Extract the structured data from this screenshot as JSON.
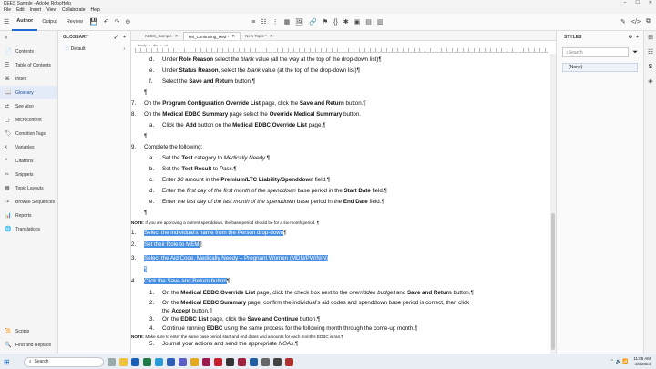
{
  "window": {
    "title": "KEES Sample - Adobe RoboHelp",
    "controls": [
      "–",
      "☐",
      "✕"
    ]
  },
  "menu": [
    "File",
    "Edit",
    "Insert",
    "View",
    "Collaborate",
    "Help"
  ],
  "toolbar": {
    "tabs": [
      "Author",
      "Output",
      "Review"
    ]
  },
  "left_nav": {
    "items": [
      {
        "label": "Contents",
        "icon": "contents-icon"
      },
      {
        "label": "Table of Contents",
        "icon": "toc-icon"
      },
      {
        "label": "Index",
        "icon": "index-icon"
      },
      {
        "label": "Glossary",
        "icon": "glossary-icon"
      },
      {
        "label": "See Also",
        "icon": "see-also-icon"
      },
      {
        "label": "Microcontent",
        "icon": "microcontent-icon"
      },
      {
        "label": "Condition Tags",
        "icon": "condition-tags-icon"
      },
      {
        "label": "Variables",
        "icon": "variables-icon"
      },
      {
        "label": "Citations",
        "icon": "citations-icon"
      },
      {
        "label": "Snippets",
        "icon": "snippets-icon"
      },
      {
        "label": "Topic Layouts",
        "icon": "topic-layouts-icon"
      },
      {
        "label": "Browse Sequences",
        "icon": "browse-sequences-icon"
      },
      {
        "label": "Reports",
        "icon": "reports-icon"
      },
      {
        "label": "Translations",
        "icon": "translations-icon"
      }
    ],
    "bottom": [
      {
        "label": "Scripts",
        "icon": "scripts-icon"
      },
      {
        "label": "Find and Replace",
        "icon": "find-replace-icon"
      }
    ]
  },
  "glossary": {
    "title": "GLOSSARY",
    "items": [
      "Default"
    ]
  },
  "editor": {
    "tabs": [
      "KEES_Sample",
      "FM_Continuing_Med *",
      "New Topic *"
    ],
    "breadcrumb": [
      "body",
      "div",
      "ol"
    ],
    "lines": [
      {
        "m": "d.",
        "t": "Under <b>Role Reason</b> select the <i>blank</i> value (all the way at the top of the drop-down list)¶",
        "ind": 1
      },
      {
        "m": "e.",
        "t": "Under <b>Status Reason</b>, select the <i>blank</i> value (at the top of the drop-down list)¶",
        "ind": 1
      },
      {
        "m": "f.",
        "t": "Select the <b>Save and Return</b> button.¶",
        "ind": 1
      },
      {
        "m": "",
        "t": "¶",
        "ind": 0
      },
      {
        "m": "7.",
        "t": "On the <b>Program Configuration Override List</b> page, click the <b>Save and Return</b> button.¶",
        "ind": 0
      },
      {
        "m": "8.",
        "t": "On the <b>Medical EDBC Summary</b> page select the <b>Override Medical Summary</b> button.",
        "ind": 0
      },
      {
        "m": "a.",
        "t": "Click the <b>Add</b> button on the <b>Medical EDBC Override List</b> page.¶",
        "ind": 1
      },
      {
        "m": "",
        "t": "¶",
        "ind": 0
      },
      {
        "m": "9.",
        "t": "Complete the following:",
        "ind": 0
      },
      {
        "m": "a.",
        "t": "Set the <b>Test</b> category to <i>Medically Needy</i>.¶",
        "ind": 1
      },
      {
        "m": "b.",
        "t": "Set the <b>Test Result</b> to <i>Pass</i>.¶",
        "ind": 1
      },
      {
        "m": "c.",
        "t": "Enter <i>$0</i> amount in the <b>Premium/LTC Liability/Spenddown</b> field.¶",
        "ind": 1
      },
      {
        "m": "d.",
        "t": "Enter the <i>first day of the first month of the spenddown</i> base period in the <b>Start Date</b> field.¶",
        "ind": 1
      },
      {
        "m": "e.",
        "t": "Enter the <i>last day of the last month of the spenddown</i> base period in the <b>End Date</b> field.¶",
        "ind": 1
      },
      {
        "m": "",
        "t": "¶",
        "ind": 0
      },
      {
        "m": "",
        "t": "<b>NOTE</b>: If you are approving a current spenddown, the base period should be for a six-month period. ¶",
        "ind": 0,
        "small": true
      },
      {
        "m": "1.",
        "t": "<span class=\"sel\">Select the individual's name from the Person drop-down</span>¶",
        "ind": 0
      },
      {
        "m": "2.",
        "t": "<span class=\"sel\">Set their Role to MEM</span>¶",
        "ind": 0
      },
      {
        "m": "3.",
        "t": "<span class=\"sel\">Select the Aid Code, Medically Needy – Pregnant Women (MDN/PW/N/N)</span>",
        "ind": 0
      },
      {
        "m": "",
        "t": "<span class=\"sel\">¶</span>",
        "ind": 0
      },
      {
        "m": "4.",
        "t": "<span class=\"sel\">Click the Save and Return button</span>¶",
        "ind": 0
      },
      {
        "m": "1.",
        "t": "On the <b>Medical EDBC Override List</b> page, click the check box next to the <i>overridden budget</i> and <b>Save and Return</b> button.¶",
        "ind": 1
      },
      {
        "m": "2.",
        "t": "On the <b>Medical EDBC Summary</b> page, confirm the individual's aid codes and spenddown base period is correct, then click",
        "ind": 1
      },
      {
        "m": "",
        "t": "the <b>Accept</b> button.¶",
        "ind": 1
      },
      {
        "m": "3.",
        "t": "On the <b>EDBC List</b> page, click the <b>Save and Continue</b> button.¶",
        "ind": 1
      },
      {
        "m": "4.",
        "t": "Continue running <b>EDBC</b> using the same process for the following month through the come-up month.¶",
        "ind": 1
      },
      {
        "m": "",
        "t": "<b>NOTE</b>: Make sure to enter the same base period start and end dates and amounts for each month's EDBC is ran.¶",
        "ind": 0,
        "small": true
      },
      {
        "m": "5.",
        "t": "Journal your actions and send the appropriate <i>NOAs</i>.¶",
        "ind": 1
      }
    ]
  },
  "styles": {
    "title": "STYLES",
    "search_placeholder": "Search",
    "items": [
      "(None)"
    ]
  },
  "taskbar": {
    "search_placeholder": "Search",
    "time": "11:08 AM",
    "date": "4/8/2024"
  }
}
